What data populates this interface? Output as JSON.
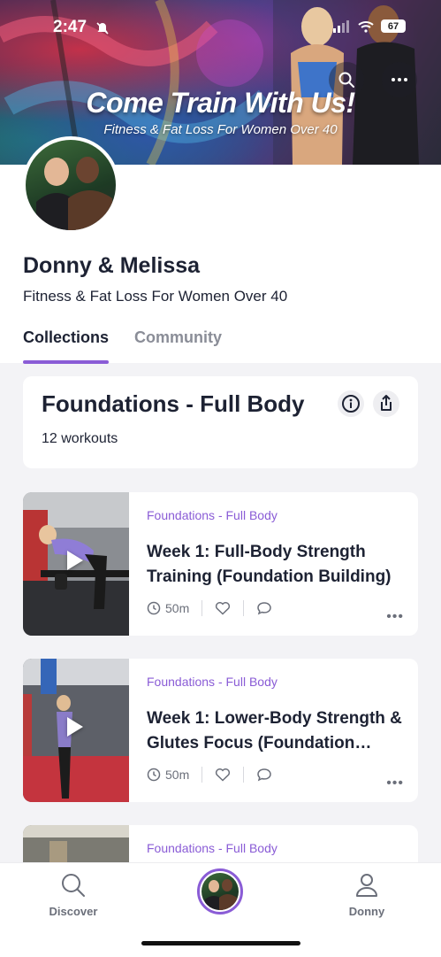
{
  "status_bar": {
    "time": "2:47",
    "battery": "67"
  },
  "hero": {
    "title": "Come Train With Us!",
    "subtitle": "Fitness & Fat Loss For Women Over 40"
  },
  "profile": {
    "name": "Donny & Melissa",
    "tagline": "Fitness & Fat Loss For Women Over 40"
  },
  "tabs": [
    {
      "label": "Collections",
      "active": true
    },
    {
      "label": "Community",
      "active": false
    }
  ],
  "collection": {
    "title": "Foundations - Full Body",
    "count": "12 workouts"
  },
  "workouts": [
    {
      "collection": "Foundations - Full Body",
      "title": "Week 1: Full-Body Strength Training (Foundation Building)",
      "duration": "50m"
    },
    {
      "collection": "Foundations - Full Body",
      "title": "Week 1: Lower-Body Strength & Glutes Focus (Foundation…",
      "duration": "50m"
    },
    {
      "collection": "Foundations - Full Body",
      "title": "",
      "duration": ""
    }
  ],
  "bottom_nav": {
    "discover": "Discover",
    "profile": "Donny"
  },
  "colors": {
    "accent": "#8a5cd6",
    "text_primary": "#1d2233",
    "text_muted": "#8a8d97",
    "background": "#f3f3f6"
  },
  "icons": [
    "bell-slash-icon",
    "signal-icon",
    "wifi-icon",
    "search-icon",
    "more-icon",
    "info-icon",
    "share-icon",
    "clock-icon",
    "heart-icon",
    "comment-icon",
    "play-icon",
    "person-icon"
  ]
}
